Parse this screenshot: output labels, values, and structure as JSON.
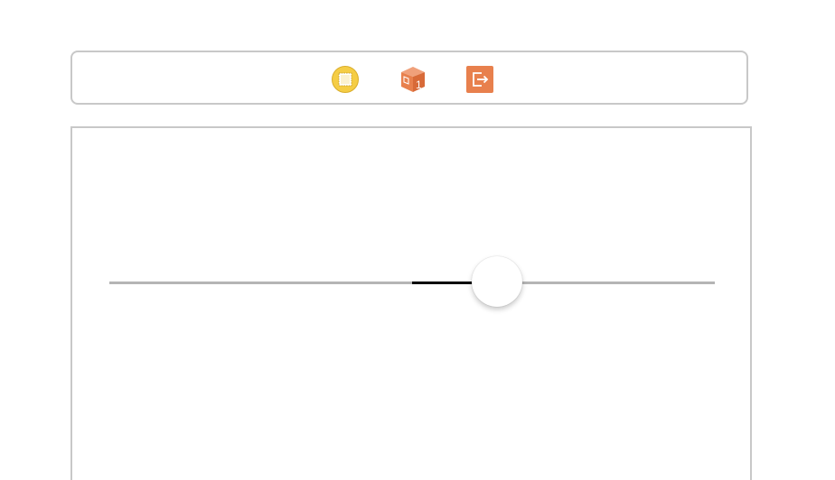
{
  "scene_dock": {
    "icons": [
      {
        "name": "view-controller-icon",
        "color": "#f5cd45"
      },
      {
        "name": "first-responder-icon",
        "color": "#e8804d"
      },
      {
        "name": "exit-icon",
        "color": "#e8804d"
      }
    ]
  },
  "slider": {
    "value": 0.64,
    "fill_start": 0.5,
    "track_color": "#b5b5b5",
    "fill_color": "#000000",
    "thumb_color": "#ffffff"
  }
}
